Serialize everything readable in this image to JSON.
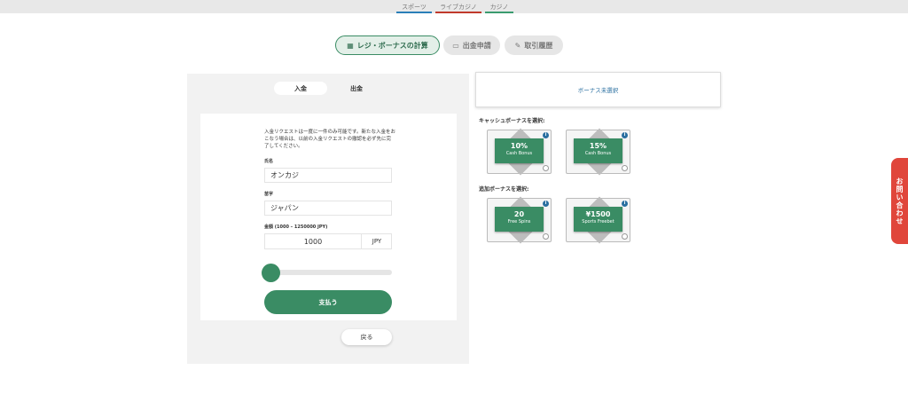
{
  "top_nav": {
    "sports": "スポーツ",
    "live_casino": "ライブカジノ",
    "casino": "カジノ"
  },
  "main_tabs": {
    "cashier": "レジ・ボーナスの計算",
    "withdraw": "出金申請",
    "history": "取引履歴"
  },
  "sub_tabs": {
    "deposit": "入金",
    "withdraw": "出金"
  },
  "form": {
    "notice": "入金リクエストは一度に一件のみ可能です。新たな入金をおこなう場合は、以前の入金リクエストの撤認を必ず先に完了してください。",
    "name_label": "氏名",
    "name_value": "オンカジ",
    "surname_label": "苗字",
    "surname_value": "ジャパン",
    "amount_label": "金額 (1000 – 1250000 JPY)",
    "amount_value": "1000",
    "currency": "JPY",
    "slider_level": 0,
    "pay_button": "支払う",
    "back_button": "戻る"
  },
  "bonus": {
    "none_selected": "ボーナス未選択",
    "cash_heading": "キャッシュボーナスを選択:",
    "extra_heading": "追加ボーナスを選択:",
    "cash_bonuses": [
      {
        "value": "10%",
        "label": "Cash Bonus"
      },
      {
        "value": "15%",
        "label": "Cash Bonus"
      }
    ],
    "extra_bonuses": [
      {
        "value": "20",
        "label": "Free Spins"
      },
      {
        "value": "¥1500",
        "label": "Sports Freebet"
      }
    ],
    "info_glyph": "i"
  },
  "contact_button": "お問い合わせ",
  "colors": {
    "primary": "#3a8c64",
    "contact": "#e0463b",
    "link": "#2a6fa0"
  }
}
